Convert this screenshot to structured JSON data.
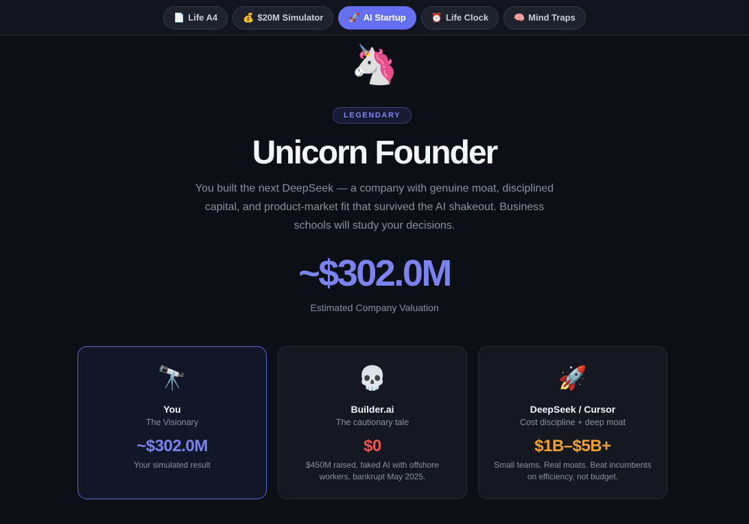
{
  "nav": {
    "tabs": [
      {
        "icon": "📄",
        "label": "Life A4"
      },
      {
        "icon": "💰",
        "label": "$20M Simulator"
      },
      {
        "icon": "🚀",
        "label": "AI Startup",
        "active": true
      },
      {
        "icon": "⏰",
        "label": "Life Clock"
      },
      {
        "icon": "🧠",
        "label": "Mind Traps"
      }
    ]
  },
  "result": {
    "emoji": "🦄",
    "badge": "LEGENDARY",
    "title": "Unicorn Founder",
    "description": "You built the next DeepSeek — a company with genuine moat, disciplined capital, and product-market fit that survived the AI shakeout. Business schools will study your decisions.",
    "valuation": "~$302.0M",
    "valuation_label": "Estimated Company Valuation"
  },
  "comparisons": [
    {
      "emoji": "🔭",
      "name": "You",
      "subtitle": "The Visionary",
      "value": "~$302.0M",
      "note": "Your simulated result",
      "value_color": "#7b83ef"
    },
    {
      "emoji": "💀",
      "name": "Builder.ai",
      "subtitle": "The cautionary tale",
      "value": "$0",
      "note": "$450M raised, faked AI with offshore workers, bankrupt May 2025.",
      "value_color": "#ef5350"
    },
    {
      "emoji": "🚀",
      "name": "DeepSeek / Cursor",
      "subtitle": "Cost discipline + deep moat",
      "value": "$1B–$5B+",
      "note": "Small teams. Real moats. Beat incumbents on efficiency, not budget.",
      "value_color": "#f0a030"
    }
  ],
  "colors": {
    "accent": "#6470f0",
    "background": "#0d0f17"
  }
}
